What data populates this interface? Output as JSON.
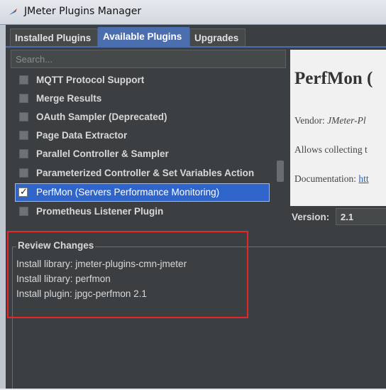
{
  "window": {
    "title": "JMeter Plugins Manager"
  },
  "tabs": [
    {
      "label": "Installed Plugins"
    },
    {
      "label": "Available Plugins"
    },
    {
      "label": "Upgrades"
    }
  ],
  "search": {
    "placeholder": "Search..."
  },
  "plugins": [
    {
      "label": "MQTT Protocol Support",
      "checked": false
    },
    {
      "label": "Merge Results",
      "checked": false
    },
    {
      "label": "OAuth Sampler (Deprecated)",
      "checked": false
    },
    {
      "label": "Page Data Extractor",
      "checked": false
    },
    {
      "label": "Parallel Controller & Sampler",
      "checked": false
    },
    {
      "label": "Parameterized Controller & Set Variables Action",
      "checked": false
    },
    {
      "label": "PerfMon (Servers Performance Monitoring)",
      "checked": true,
      "selected": true
    },
    {
      "label": "Prometheus Listener Plugin",
      "checked": false
    }
  ],
  "detail": {
    "name": "PerfMon (",
    "vendor_label": "Vendor:",
    "vendor_value": "JMeter-Pl",
    "description": "Allows collecting t",
    "doc_label": "Documentation:",
    "doc_link": "htt"
  },
  "version": {
    "label": "Version:",
    "value": "2.1"
  },
  "review": {
    "title": "Review Changes",
    "changes": [
      "Install library: jmeter-plugins-cmn-jmeter",
      "Install library: perfmon",
      "Install plugin: jpgc-perfmon 2.1"
    ]
  },
  "colors": {
    "accent": "#4b6eaf",
    "selection": "#2f65ca",
    "highlight": "#e8262a"
  }
}
